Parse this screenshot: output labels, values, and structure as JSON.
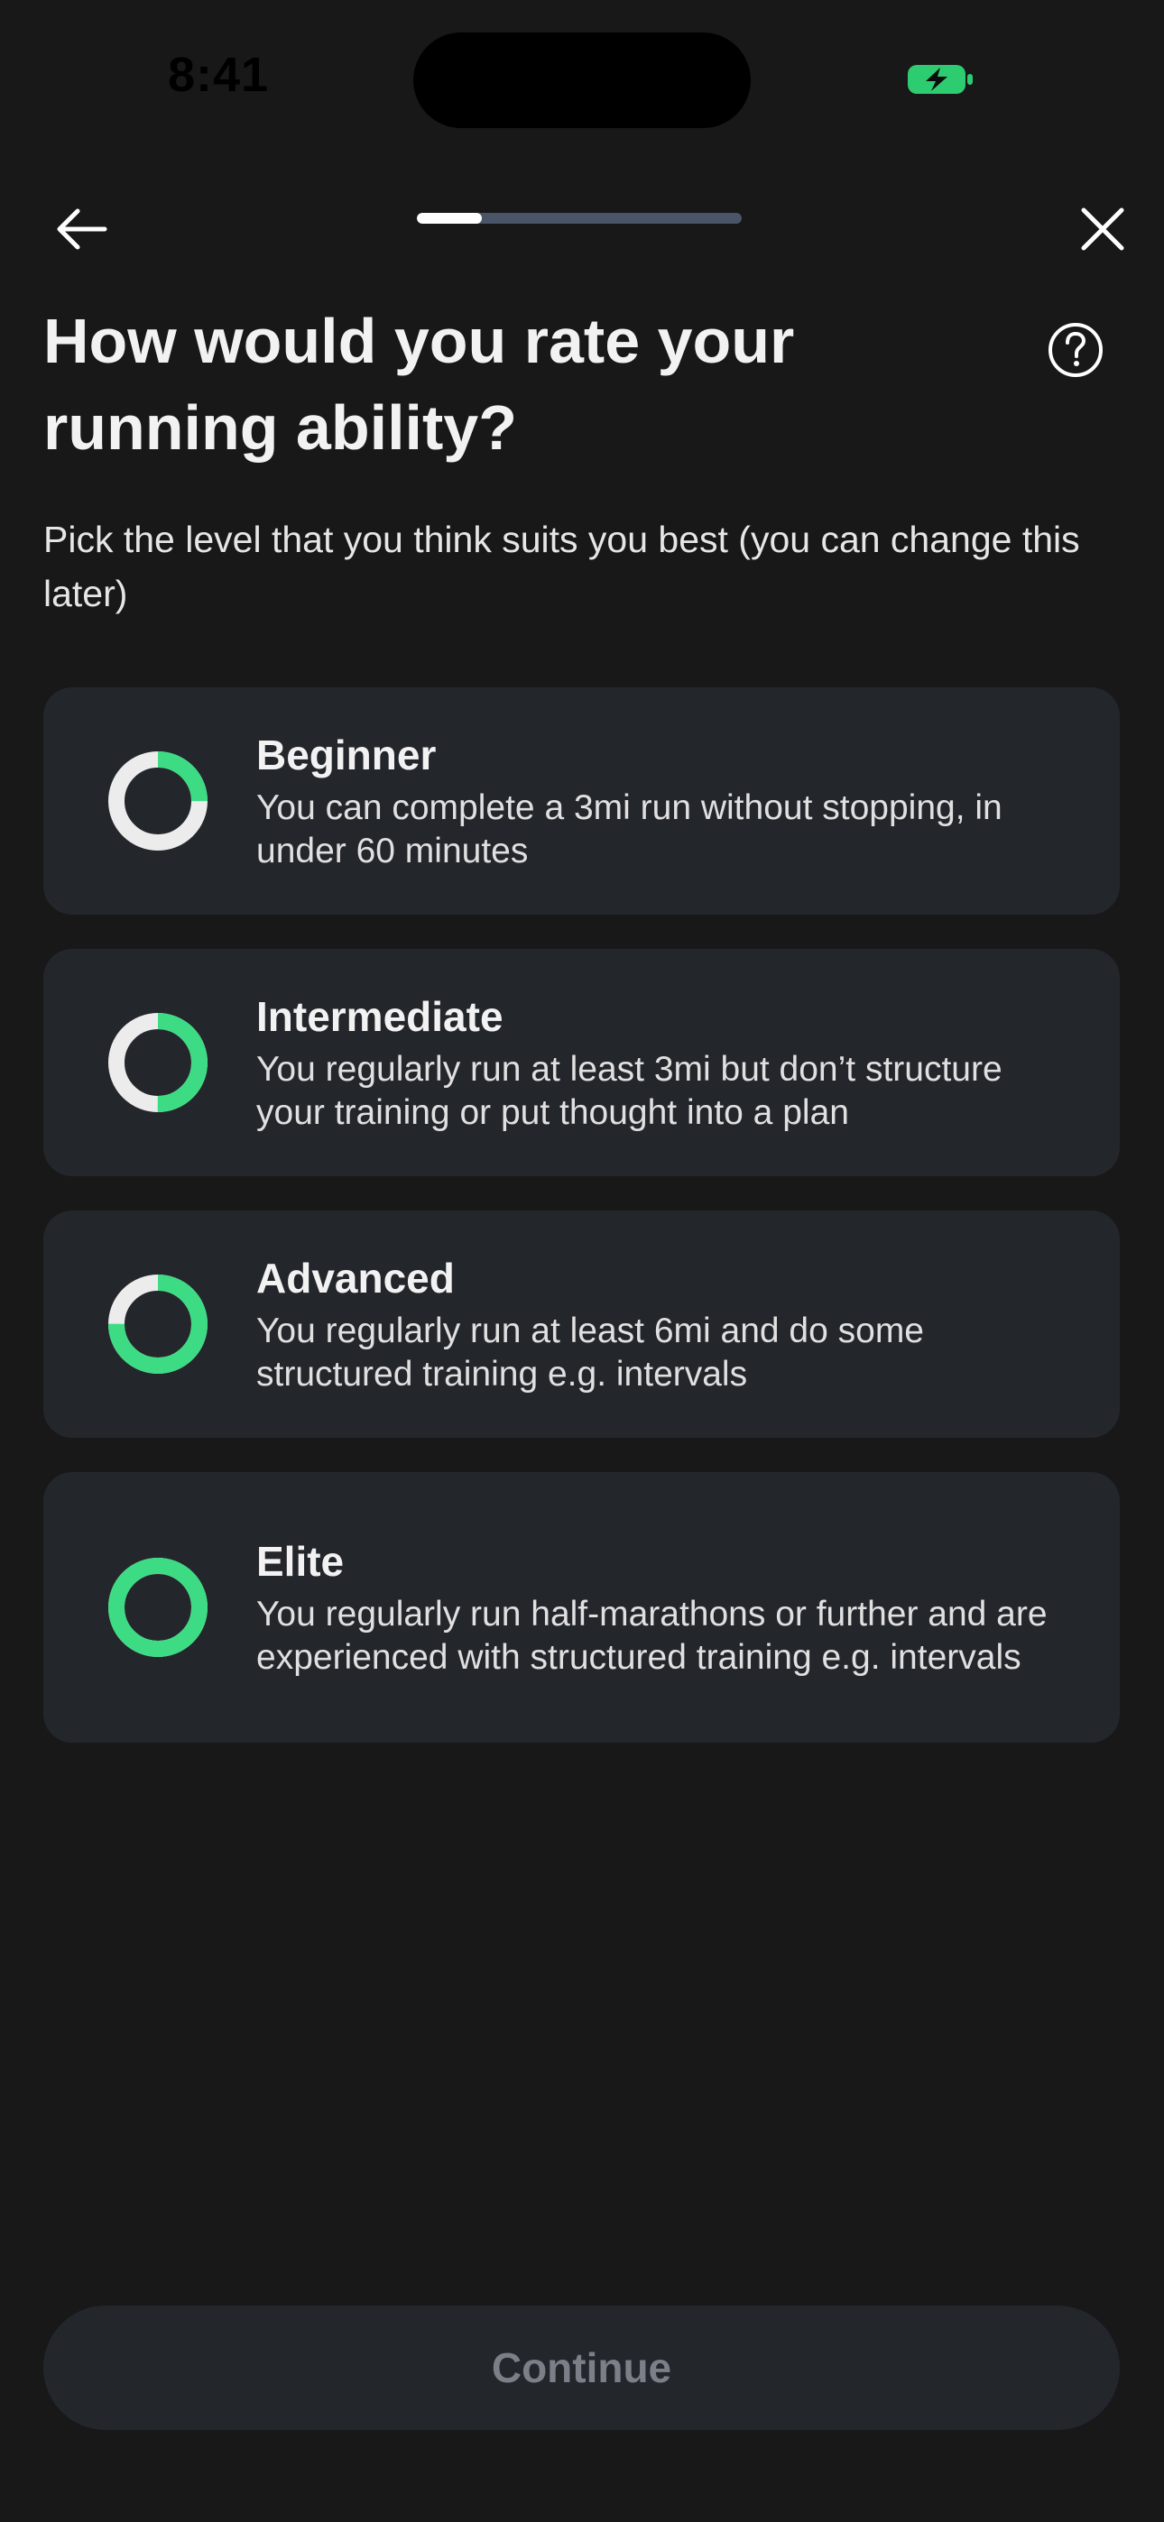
{
  "status_bar": {
    "time": "8:41",
    "battery_icon": "battery-charging-icon",
    "battery_color": "#2ecc71"
  },
  "nav": {
    "back_icon": "arrow-left-icon",
    "close_icon": "close-icon",
    "progress_fraction": 0.2
  },
  "header": {
    "title": "How would you rate your running ability?",
    "help_icon": "question-circle-icon"
  },
  "subtitle": "Pick the level that you think suits you best (you can change this later)",
  "options": [
    {
      "title": "Beginner",
      "description": "You can complete a 3mi run without stopping, in under 60 minutes",
      "level_fraction": 0.25
    },
    {
      "title": "Intermediate",
      "description": "You regularly run at least 3mi but don’t structure your training or put thought into a plan",
      "level_fraction": 0.5
    },
    {
      "title": "Advanced",
      "description": "You regularly run at least 6mi and do some structured training e.g. intervals",
      "level_fraction": 0.75
    },
    {
      "title": "Elite",
      "description": "You regularly run half-marathons or further and are experienced with structured training e.g. intervals",
      "level_fraction": 1.0
    }
  ],
  "continue_label": "Continue",
  "colors": {
    "background": "#181818",
    "card": "#23262b",
    "accent_green": "#3ddc84",
    "ring_track": "#ececec",
    "progress_track": "#4a5568",
    "disabled_text": "#7a7f88"
  }
}
